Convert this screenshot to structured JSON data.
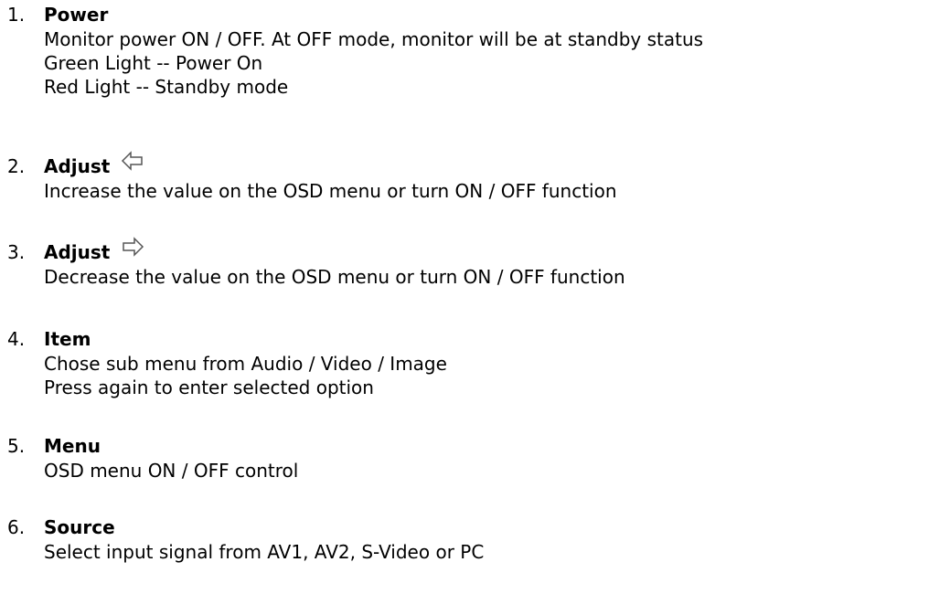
{
  "items": [
    {
      "number": "1.",
      "title": "Power",
      "lines": [
        "Monitor power ON / OFF. At OFF mode, monitor will be at standby status",
        "Green Light -- Power On",
        "Red Light -- Standby mode"
      ]
    },
    {
      "number": "2.",
      "title": "Adjust",
      "icon": "left-arrow-outline-icon",
      "lines": [
        "Increase the value on the OSD menu or turn ON / OFF function"
      ]
    },
    {
      "number": "3.",
      "title": "Adjust",
      "icon": "right-arrow-outline-icon",
      "lines": [
        "Decrease the value on the OSD menu or turn ON / OFF function"
      ]
    },
    {
      "number": "4.",
      "title": "Item",
      "lines": [
        "Chose sub menu from Audio / Video / Image",
        "Press again to enter selected option"
      ]
    },
    {
      "number": "5.",
      "title": "Menu",
      "lines": [
        "OSD menu ON / OFF control"
      ]
    },
    {
      "number": "6.",
      "title": "Source",
      "lines": [
        "Select input signal from AV1, AV2, S-Video or PC"
      ]
    }
  ]
}
